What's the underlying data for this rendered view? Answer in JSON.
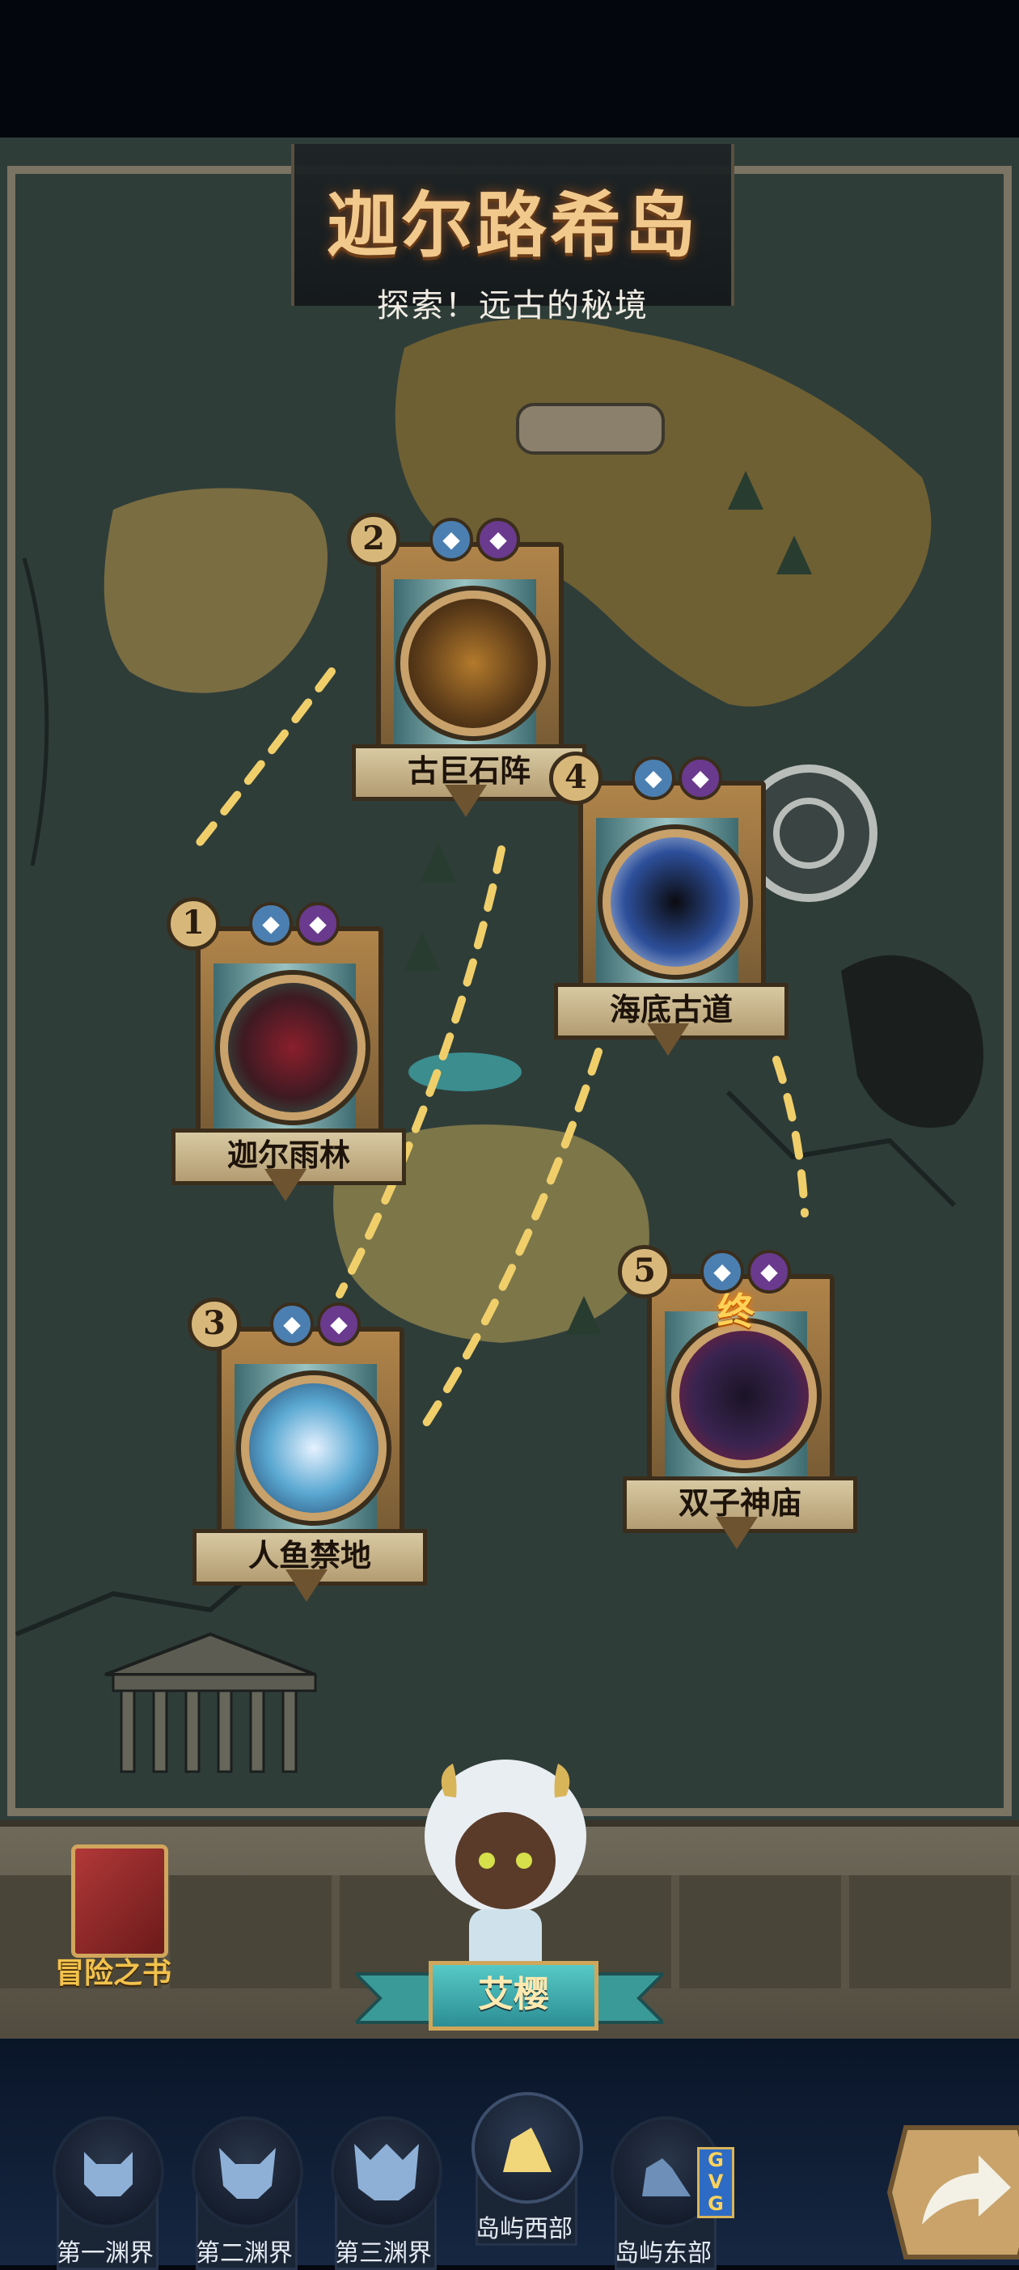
{
  "header": {
    "title": "迦尔路希岛",
    "subtitle": "探索！远古的秘境"
  },
  "nodes": [
    {
      "number": "2",
      "name": "古巨石阵"
    },
    {
      "number": "4",
      "name": "海底古道"
    },
    {
      "number": "1",
      "name": "迦尔雨林"
    },
    {
      "number": "3",
      "name": "人鱼禁地"
    },
    {
      "number": "5",
      "name": "双子神庙",
      "final_mark": "终"
    }
  ],
  "book": {
    "label": "冒险之书"
  },
  "character": {
    "name": "艾樱"
  },
  "nav": {
    "items": [
      {
        "label": "第一渊界"
      },
      {
        "label": "第二渊界"
      },
      {
        "label": "第三渊界"
      },
      {
        "label": "岛屿西部",
        "active": true
      },
      {
        "label": "岛屿东部",
        "tag": "GVG"
      }
    ]
  },
  "colors": {
    "title": "#f2c98c",
    "nav_bg": "#0a1528",
    "map_bg": "#2b3a36",
    "label_gold": "#f3c24c"
  }
}
